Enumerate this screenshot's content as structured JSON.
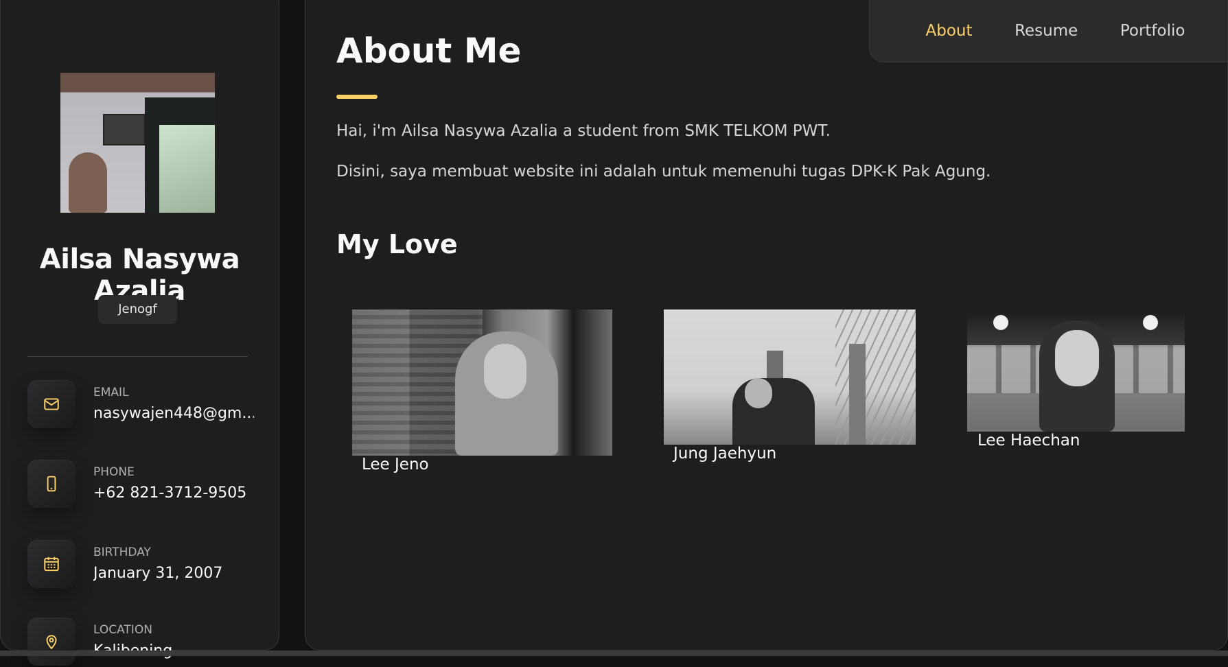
{
  "sidebar": {
    "name": "Ailsa Nasywa Azalia",
    "title": "Jenogf",
    "contacts": [
      {
        "label": "Email",
        "value": "nasywajen448@gm...",
        "icon": "mail-icon"
      },
      {
        "label": "Phone",
        "value": "+62 821-3712-9505",
        "icon": "phone-icon"
      },
      {
        "label": "Birthday",
        "value": "January 31, 2007",
        "icon": "calendar-icon"
      },
      {
        "label": "Location",
        "value": "Kalibening",
        "icon": "location-icon"
      }
    ]
  },
  "navbar": {
    "links": [
      "About",
      "Resume",
      "Portfolio"
    ],
    "active": "About"
  },
  "about": {
    "title": "About Me",
    "paragraphs": [
      "Hai, i'm Ailsa Nasywa Azalia a student from SMK TELKOM PWT.",
      "Disini, saya membuat website ini adalah untuk memenuhi tugas DPK-K Pak Agung."
    ]
  },
  "love": {
    "title": "My Love",
    "items": [
      {
        "name": "Lee Jeno"
      },
      {
        "name": "Jung Jaehyun"
      },
      {
        "name": "Lee Haechan"
      }
    ]
  },
  "colors": {
    "accent": "#ffd166",
    "background": "#121212",
    "panel": "#1e1e1f"
  }
}
